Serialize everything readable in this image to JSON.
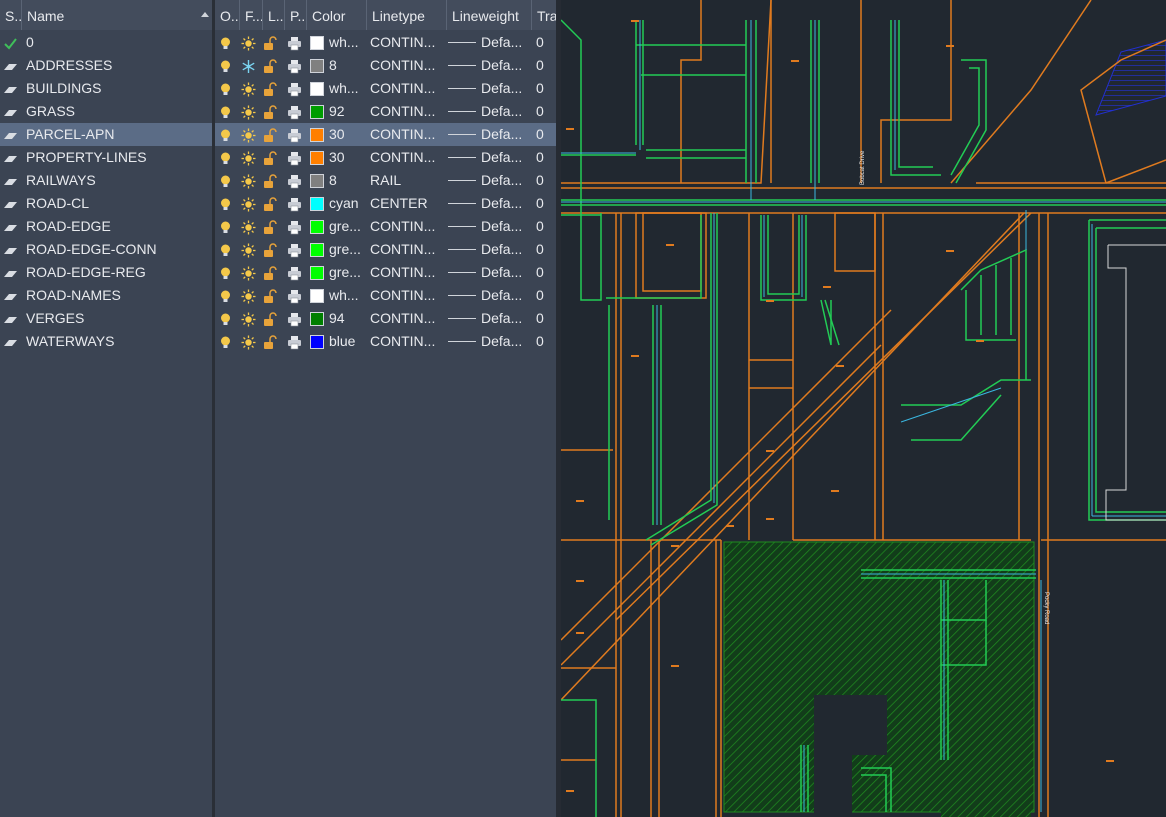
{
  "layer_tree": {
    "header": {
      "status": "S...",
      "name": "Name"
    },
    "layers": [
      {
        "name": "0",
        "current": true
      },
      {
        "name": "ADDRESSES"
      },
      {
        "name": "BUILDINGS"
      },
      {
        "name": "GRASS"
      },
      {
        "name": "PARCEL-APN",
        "selected": true
      },
      {
        "name": "PROPERTY-LINES"
      },
      {
        "name": "RAILWAYS"
      },
      {
        "name": "ROAD-CL"
      },
      {
        "name": "ROAD-EDGE"
      },
      {
        "name": "ROAD-EDGE-CONN"
      },
      {
        "name": "ROAD-EDGE-REG"
      },
      {
        "name": "ROAD-NAMES"
      },
      {
        "name": "VERGES"
      },
      {
        "name": "WATERWAYS"
      }
    ]
  },
  "properties_grid": {
    "headers": {
      "on": "O...",
      "freeze": "F...",
      "lock": "L...",
      "plot": "P...",
      "color": "Color",
      "linetype": "Linetype",
      "lineweight": "Lineweight",
      "transparency": "Tra"
    },
    "rows": [
      {
        "freeze": "thaw",
        "color_name": "wh...",
        "swatch": "#ffffff",
        "linetype": "CONTIN...",
        "lineweight": "Defa...",
        "transparency": "0"
      },
      {
        "freeze": "frozen",
        "color_name": "8",
        "swatch": "#808080",
        "linetype": "CONTIN...",
        "lineweight": "Defa...",
        "transparency": "0"
      },
      {
        "freeze": "thaw",
        "color_name": "wh...",
        "swatch": "#ffffff",
        "linetype": "CONTIN...",
        "lineweight": "Defa...",
        "transparency": "0"
      },
      {
        "freeze": "thaw",
        "color_name": "92",
        "swatch": "#009d00",
        "linetype": "CONTIN...",
        "lineweight": "Defa...",
        "transparency": "0"
      },
      {
        "freeze": "thaw",
        "color_name": "30",
        "swatch": "#ff7f00",
        "linetype": "CONTIN...",
        "lineweight": "Defa...",
        "transparency": "0"
      },
      {
        "freeze": "thaw",
        "color_name": "30",
        "swatch": "#ff7f00",
        "linetype": "CONTIN...",
        "lineweight": "Defa...",
        "transparency": "0"
      },
      {
        "freeze": "thaw",
        "color_name": "8",
        "swatch": "#808080",
        "linetype": "RAIL",
        "lineweight": "Defa...",
        "transparency": "0"
      },
      {
        "freeze": "thaw",
        "color_name": "cyan",
        "swatch": "#00ffff",
        "linetype": "CENTER",
        "lineweight": "Defa...",
        "transparency": "0"
      },
      {
        "freeze": "thaw",
        "color_name": "gre...",
        "swatch": "#00ff00",
        "linetype": "CONTIN...",
        "lineweight": "Defa...",
        "transparency": "0"
      },
      {
        "freeze": "thaw",
        "color_name": "gre...",
        "swatch": "#00ff00",
        "linetype": "CONTIN...",
        "lineweight": "Defa...",
        "transparency": "0"
      },
      {
        "freeze": "thaw",
        "color_name": "gre...",
        "swatch": "#00ff00",
        "linetype": "CONTIN...",
        "lineweight": "Defa...",
        "transparency": "0"
      },
      {
        "freeze": "thaw",
        "color_name": "wh...",
        "swatch": "#ffffff",
        "linetype": "CONTIN...",
        "lineweight": "Defa...",
        "transparency": "0"
      },
      {
        "freeze": "thaw",
        "color_name": "94",
        "swatch": "#007f00",
        "linetype": "CONTIN...",
        "lineweight": "Defa...",
        "transparency": "0"
      },
      {
        "freeze": "thaw",
        "color_name": "blue",
        "swatch": "#0000ff",
        "linetype": "CONTIN...",
        "lineweight": "Defa...",
        "transparency": "0"
      }
    ]
  },
  "drawing": {
    "background": "#212830",
    "street_labels": [
      "Bobcat Drive",
      "Pocky Road"
    ],
    "colors": {
      "property": "#e07b1f",
      "road_edge": "#22cc55",
      "road_cl": "#3ab7e0",
      "grass": "#1f8a1f",
      "waterway": "#2230d0",
      "building": "#d8d8d8"
    }
  },
  "colors": {
    "panel": "#3b4453",
    "header": "#434c5c",
    "selected_row": "#5b6c86",
    "check": "#3fbf5a",
    "bulb": "#f4c84a",
    "lock": "#e8a33a"
  }
}
